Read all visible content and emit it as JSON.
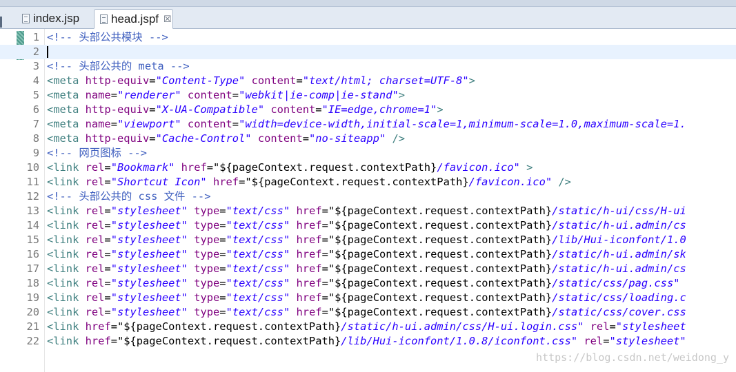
{
  "tabs": [
    {
      "label": "index.jsp",
      "active": false
    },
    {
      "label": "head.jspf",
      "active": true
    }
  ],
  "close_glyph": "☒",
  "current_line": 2,
  "lines": [
    {
      "n": "1",
      "tokens": [
        [
          "cm",
          "<!-- 头部公共模块 -->"
        ]
      ]
    },
    {
      "n": "2",
      "tokens": []
    },
    {
      "n": "3",
      "tokens": [
        [
          "cm",
          "<!-- 头部公共的 meta -->"
        ]
      ]
    },
    {
      "n": "4",
      "tokens": [
        [
          "tg",
          "<meta "
        ],
        [
          "at",
          "http-equiv"
        ],
        [
          "tx",
          "="
        ],
        [
          "vl",
          "\"Content-Type\""
        ],
        [
          "tx",
          " "
        ],
        [
          "at",
          "content"
        ],
        [
          "tx",
          "="
        ],
        [
          "vl",
          "\"text/html; charset=UTF-8\""
        ],
        [
          "tg",
          ">"
        ]
      ]
    },
    {
      "n": "5",
      "tokens": [
        [
          "tg",
          "<meta "
        ],
        [
          "at",
          "name"
        ],
        [
          "tx",
          "="
        ],
        [
          "vl",
          "\"renderer\""
        ],
        [
          "tx",
          " "
        ],
        [
          "at",
          "content"
        ],
        [
          "tx",
          "="
        ],
        [
          "vl",
          "\"webkit|ie-comp|ie-stand\""
        ],
        [
          "tg",
          ">"
        ]
      ]
    },
    {
      "n": "6",
      "tokens": [
        [
          "tg",
          "<meta "
        ],
        [
          "at",
          "http-equiv"
        ],
        [
          "tx",
          "="
        ],
        [
          "vl",
          "\"X-UA-Compatible\""
        ],
        [
          "tx",
          " "
        ],
        [
          "at",
          "content"
        ],
        [
          "tx",
          "="
        ],
        [
          "vl",
          "\"IE=edge,chrome=1\""
        ],
        [
          "tg",
          ">"
        ]
      ]
    },
    {
      "n": "7",
      "tokens": [
        [
          "tg",
          "<meta "
        ],
        [
          "at",
          "name"
        ],
        [
          "tx",
          "="
        ],
        [
          "vl",
          "\"viewport\""
        ],
        [
          "tx",
          " "
        ],
        [
          "at",
          "content"
        ],
        [
          "tx",
          "="
        ],
        [
          "vl",
          "\"width=device-width,initial-scale=1,minimum-scale=1.0,maximum-scale=1."
        ]
      ]
    },
    {
      "n": "8",
      "tokens": [
        [
          "tg",
          "<meta "
        ],
        [
          "at",
          "http-equiv"
        ],
        [
          "tx",
          "="
        ],
        [
          "vl",
          "\"Cache-Control\""
        ],
        [
          "tx",
          " "
        ],
        [
          "at",
          "content"
        ],
        [
          "tx",
          "="
        ],
        [
          "vl",
          "\"no-siteapp\""
        ],
        [
          "tx",
          " "
        ],
        [
          "tg",
          "/>"
        ]
      ]
    },
    {
      "n": "9",
      "tokens": [
        [
          "cm",
          "<!-- 网页图标 -->"
        ]
      ]
    },
    {
      "n": "10",
      "tokens": [
        [
          "tg",
          "<link "
        ],
        [
          "at",
          "rel"
        ],
        [
          "tx",
          "="
        ],
        [
          "vl",
          "\"Bookmark\""
        ],
        [
          "tx",
          " "
        ],
        [
          "at",
          "href"
        ],
        [
          "tx",
          "=\"${pageContext.request.contextPath}"
        ],
        [
          "vl",
          "/favicon.ico\""
        ],
        [
          "tx",
          " "
        ],
        [
          "tg",
          ">"
        ]
      ]
    },
    {
      "n": "11",
      "tokens": [
        [
          "tg",
          "<link "
        ],
        [
          "at",
          "rel"
        ],
        [
          "tx",
          "="
        ],
        [
          "vl",
          "\"Shortcut Icon\""
        ],
        [
          "tx",
          " "
        ],
        [
          "at",
          "href"
        ],
        [
          "tx",
          "=\"${pageContext.request.contextPath}"
        ],
        [
          "vl",
          "/favicon.ico\""
        ],
        [
          "tx",
          " "
        ],
        [
          "tg",
          "/>"
        ]
      ]
    },
    {
      "n": "12",
      "tokens": [
        [
          "cm",
          "<!-- 头部公共的 css 文件 -->"
        ]
      ]
    },
    {
      "n": "13",
      "tokens": [
        [
          "tg",
          "<link "
        ],
        [
          "at",
          "rel"
        ],
        [
          "tx",
          "="
        ],
        [
          "vl",
          "\"stylesheet\""
        ],
        [
          "tx",
          " "
        ],
        [
          "at",
          "type"
        ],
        [
          "tx",
          "="
        ],
        [
          "vl",
          "\"text/css\""
        ],
        [
          "tx",
          " "
        ],
        [
          "at",
          "href"
        ],
        [
          "tx",
          "=\"${pageContext.request.contextPath}"
        ],
        [
          "vl",
          "/static/h-ui/css/H-ui"
        ]
      ]
    },
    {
      "n": "14",
      "tokens": [
        [
          "tg",
          "<link "
        ],
        [
          "at",
          "rel"
        ],
        [
          "tx",
          "="
        ],
        [
          "vl",
          "\"stylesheet\""
        ],
        [
          "tx",
          " "
        ],
        [
          "at",
          "type"
        ],
        [
          "tx",
          "="
        ],
        [
          "vl",
          "\"text/css\""
        ],
        [
          "tx",
          " "
        ],
        [
          "at",
          "href"
        ],
        [
          "tx",
          "=\"${pageContext.request.contextPath}"
        ],
        [
          "vl",
          "/static/h-ui.admin/cs"
        ]
      ]
    },
    {
      "n": "15",
      "tokens": [
        [
          "tg",
          "<link "
        ],
        [
          "at",
          "rel"
        ],
        [
          "tx",
          "="
        ],
        [
          "vl",
          "\"stylesheet\""
        ],
        [
          "tx",
          " "
        ],
        [
          "at",
          "type"
        ],
        [
          "tx",
          "="
        ],
        [
          "vl",
          "\"text/css\""
        ],
        [
          "tx",
          " "
        ],
        [
          "at",
          "href"
        ],
        [
          "tx",
          "=\"${pageContext.request.contextPath}"
        ],
        [
          "vl",
          "/lib/Hui-iconfont/1.0"
        ]
      ]
    },
    {
      "n": "16",
      "tokens": [
        [
          "tg",
          "<link "
        ],
        [
          "at",
          "rel"
        ],
        [
          "tx",
          "="
        ],
        [
          "vl",
          "\"stylesheet\""
        ],
        [
          "tx",
          " "
        ],
        [
          "at",
          "type"
        ],
        [
          "tx",
          "="
        ],
        [
          "vl",
          "\"text/css\""
        ],
        [
          "tx",
          " "
        ],
        [
          "at",
          "href"
        ],
        [
          "tx",
          "=\"${pageContext.request.contextPath}"
        ],
        [
          "vl",
          "/static/h-ui.admin/sk"
        ]
      ]
    },
    {
      "n": "17",
      "tokens": [
        [
          "tg",
          "<link "
        ],
        [
          "at",
          "rel"
        ],
        [
          "tx",
          "="
        ],
        [
          "vl",
          "\"stylesheet\""
        ],
        [
          "tx",
          " "
        ],
        [
          "at",
          "type"
        ],
        [
          "tx",
          "="
        ],
        [
          "vl",
          "\"text/css\""
        ],
        [
          "tx",
          " "
        ],
        [
          "at",
          "href"
        ],
        [
          "tx",
          "=\"${pageContext.request.contextPath}"
        ],
        [
          "vl",
          "/static/h-ui.admin/cs"
        ]
      ]
    },
    {
      "n": "18",
      "tokens": [
        [
          "tg",
          "<link "
        ],
        [
          "at",
          "rel"
        ],
        [
          "tx",
          "="
        ],
        [
          "vl",
          "\"stylesheet\""
        ],
        [
          "tx",
          " "
        ],
        [
          "at",
          "type"
        ],
        [
          "tx",
          "="
        ],
        [
          "vl",
          "\"text/css\""
        ],
        [
          "tx",
          " "
        ],
        [
          "at",
          "href"
        ],
        [
          "tx",
          "=\"${pageContext.request.contextPath}"
        ],
        [
          "vl",
          "/static/css/pag.css\""
        ]
      ]
    },
    {
      "n": "19",
      "tokens": [
        [
          "tg",
          "<link "
        ],
        [
          "at",
          "rel"
        ],
        [
          "tx",
          "="
        ],
        [
          "vl",
          "\"stylesheet\""
        ],
        [
          "tx",
          " "
        ],
        [
          "at",
          "type"
        ],
        [
          "tx",
          "="
        ],
        [
          "vl",
          "\"text/css\""
        ],
        [
          "tx",
          " "
        ],
        [
          "at",
          "href"
        ],
        [
          "tx",
          "=\"${pageContext.request.contextPath}"
        ],
        [
          "vl",
          "/static/css/loading.c"
        ]
      ]
    },
    {
      "n": "20",
      "tokens": [
        [
          "tg",
          "<link "
        ],
        [
          "at",
          "rel"
        ],
        [
          "tx",
          "="
        ],
        [
          "vl",
          "\"stylesheet\""
        ],
        [
          "tx",
          " "
        ],
        [
          "at",
          "type"
        ],
        [
          "tx",
          "="
        ],
        [
          "vl",
          "\"text/css\""
        ],
        [
          "tx",
          " "
        ],
        [
          "at",
          "href"
        ],
        [
          "tx",
          "=\"${pageContext.request.contextPath}"
        ],
        [
          "vl",
          "/static/css/cover.css"
        ]
      ]
    },
    {
      "n": "21",
      "tokens": [
        [
          "tg",
          "<link "
        ],
        [
          "at",
          "href"
        ],
        [
          "tx",
          "=\"${pageContext.request.contextPath}"
        ],
        [
          "vl",
          "/static/h-ui.admin/css/H-ui.login.css\""
        ],
        [
          "tx",
          " "
        ],
        [
          "at",
          "rel"
        ],
        [
          "tx",
          "="
        ],
        [
          "vl",
          "\"stylesheet"
        ]
      ]
    },
    {
      "n": "22",
      "tokens": [
        [
          "tg",
          "<link "
        ],
        [
          "at",
          "href"
        ],
        [
          "tx",
          "=\"${pageContext.request.contextPath}"
        ],
        [
          "vl",
          "/lib/Hui-iconfont/1.0.8/iconfont.css\""
        ],
        [
          "tx",
          " "
        ],
        [
          "at",
          "rel"
        ],
        [
          "tx",
          "="
        ],
        [
          "vl",
          "\"stylesheet\""
        ]
      ]
    }
  ],
  "watermark": "https://blog.csdn.net/weidong_y"
}
